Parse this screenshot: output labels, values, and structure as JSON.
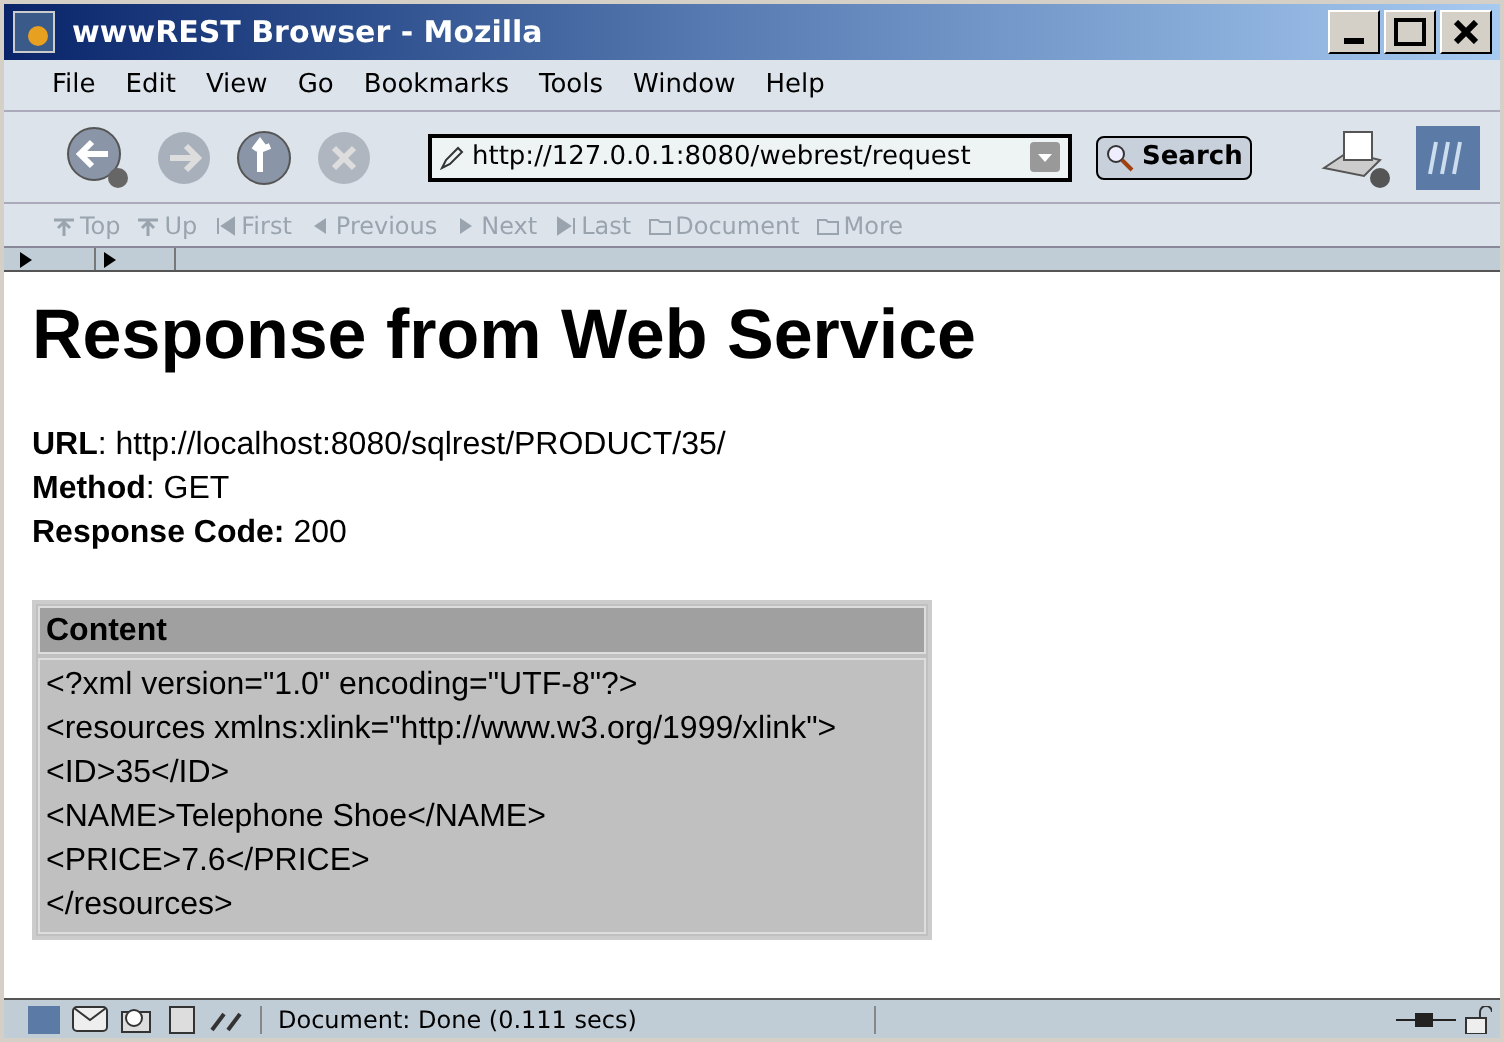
{
  "window": {
    "title": "wwwREST Browser - Mozilla"
  },
  "menu": [
    {
      "label": "File"
    },
    {
      "label": "Edit"
    },
    {
      "label": "View"
    },
    {
      "label": "Go"
    },
    {
      "label": "Bookmarks"
    },
    {
      "label": "Tools"
    },
    {
      "label": "Window"
    },
    {
      "label": "Help"
    }
  ],
  "navigation": {
    "url": "http://127.0.0.1:8080/webrest/request",
    "search_button": "Search"
  },
  "site_navigation": [
    {
      "label": "Top",
      "kind": "up",
      "disabled": true
    },
    {
      "label": "Up",
      "kind": "up",
      "disabled": true
    },
    {
      "label": "First",
      "kind": "first",
      "disabled": true
    },
    {
      "label": "Previous",
      "kind": "prev",
      "disabled": true
    },
    {
      "label": "Next",
      "kind": "next",
      "disabled": true
    },
    {
      "label": "Last",
      "kind": "last",
      "disabled": true
    },
    {
      "label": "Document",
      "kind": "folder",
      "disabled": true
    },
    {
      "label": "More",
      "kind": "folder",
      "disabled": true
    }
  ],
  "page": {
    "heading": "Response from Web Service",
    "fields": [
      {
        "label": "URL",
        "value": ": http://localhost:8080/sqlrest/PRODUCT/35/"
      },
      {
        "label": "Method",
        "value": ": GET"
      },
      {
        "label": "Response Code:",
        "value": " 200"
      }
    ],
    "table": {
      "header": "Content",
      "lines": [
        "<?xml version=\"1.0\" encoding=\"UTF-8\"?>",
        "<resources xmlns:xlink=\"http://www.w3.org/1999/xlink\">",
        "<ID>35</ID>",
        "<NAME>Telephone Shoe</NAME>",
        "<PRICE>7.6</PRICE>",
        "</resources>"
      ]
    }
  },
  "status_bar": {
    "text": "Document: Done (0.111 secs)"
  }
}
